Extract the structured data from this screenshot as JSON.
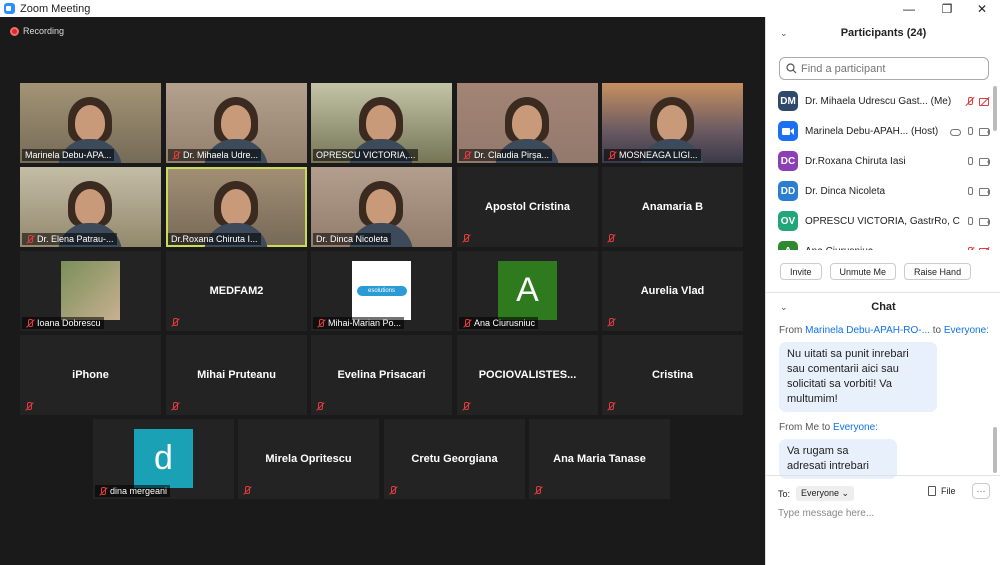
{
  "window": {
    "title": "Zoom Meeting",
    "min": "—",
    "restore": "❐",
    "close": "✕"
  },
  "recording": "Recording",
  "tiles": [
    {
      "name": "Marinela Debu-APA...",
      "video": true
    },
    {
      "name": "Dr. Mihaela Udre...",
      "video": true,
      "muted": true
    },
    {
      "name": "OPRESCU VICTORIA,...",
      "video": true
    },
    {
      "name": "Dr. Claudia Pirșa...",
      "video": true,
      "muted": true
    },
    {
      "name": "MOSNEAGA LIGI...",
      "video": true,
      "muted": true
    },
    {
      "name": "Dr. Elena Patrau-...",
      "video": true,
      "muted": true
    },
    {
      "name": "Dr.Roxana Chiruta I...",
      "video": true,
      "active": true
    },
    {
      "name": "Dr. Dinca Nicoleta",
      "video": true
    },
    {
      "name": "Apostol Cristina",
      "muted": true
    },
    {
      "name": "Anamaria B",
      "muted": true
    },
    {
      "name": "Ioana Dobrescu",
      "photo": true,
      "muted": true
    },
    {
      "name": "MEDFAM2",
      "muted": true
    },
    {
      "name": "Mihai-Marian Po...",
      "logo": "esolutions",
      "muted": true
    },
    {
      "name": "Ana Ciurusniuc",
      "letter": "A",
      "muted": true
    },
    {
      "name": "Aurelia Vlad",
      "muted": true
    },
    {
      "name": "iPhone",
      "muted": true
    },
    {
      "name": "Mihai Pruteanu",
      "muted": true
    },
    {
      "name": "Evelina Prisacari",
      "muted": true
    },
    {
      "name": "POCIOVALISTES...",
      "muted": true
    },
    {
      "name": "Cristina",
      "muted": true
    },
    {
      "name": "dina mergeani",
      "letter": "d",
      "muted": true
    },
    {
      "name": "Mirela Opritescu",
      "muted": true
    },
    {
      "name": "Cretu Georgiana",
      "muted": true
    },
    {
      "name": "Ana Maria Tanase",
      "muted": true
    }
  ],
  "participants": {
    "header": "Participants (24)",
    "search_placeholder": "Find a participant",
    "list": [
      {
        "initials": "DM",
        "color": "#2e4a6b",
        "name": "Dr. Mihaela Udrescu Gast...",
        "tag": "(Me)",
        "mic": "red",
        "cam": "red"
      },
      {
        "initials": "",
        "color": "#1d6ff2",
        "name": "Marinela Debu-APAH...",
        "tag": "(Host)",
        "cloud": true,
        "mic": "gray",
        "cam": "gray"
      },
      {
        "initials": "DC",
        "color": "#8b3fb7",
        "name": "Dr.Roxana Chiruta Iasi",
        "tag": "",
        "mic": "gray",
        "cam": "gray"
      },
      {
        "initials": "DD",
        "color": "#2a7dd1",
        "name": "Dr. Dinca Nicoleta",
        "tag": "",
        "mic": "gray",
        "cam": "gray"
      },
      {
        "initials": "OV",
        "color": "#21a67a",
        "name": "OPRESCU VICTORIA, GastrRo, C...",
        "tag": "",
        "mic": "gray",
        "cam": "gray"
      },
      {
        "initials": "A",
        "color": "#2f8a2f",
        "name": "Ana Ciurusniuc",
        "tag": "",
        "mic": "red",
        "cam": "red"
      }
    ],
    "buttons": {
      "invite": "Invite",
      "unmute": "Unmute Me",
      "raise": "Raise Hand"
    }
  },
  "chat": {
    "header": "Chat",
    "messages": [
      {
        "from_prefix": "From",
        "from": "Marinela Debu-APAH-RO-...",
        "to_prefix": "to",
        "to": "Everyone:",
        "text": "Nu uitati sa punit inrebari sau comentarii aici sau solicitati sa vorbiti! Va multumim!"
      },
      {
        "from_prefix": "From",
        "from": "Me",
        "to_prefix": "to",
        "to": "Everyone:",
        "text": "Va rugam sa adresati intrebari"
      }
    ],
    "to_label": "To:",
    "to_value": "Everyone",
    "file_label": "File",
    "more": "···",
    "placeholder": "Type message here..."
  }
}
